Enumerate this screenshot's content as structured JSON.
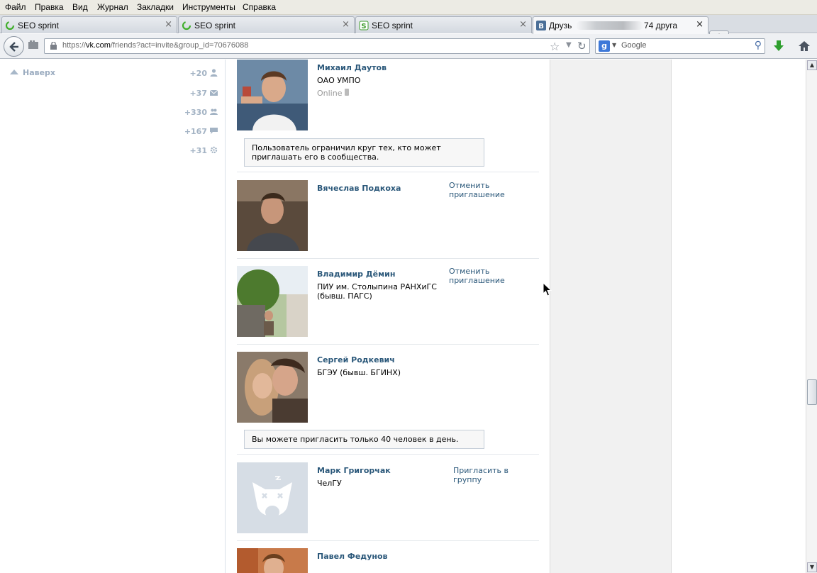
{
  "menu": [
    "Файл",
    "Правка",
    "Вид",
    "Журнал",
    "Закладки",
    "Инструменты",
    "Справка"
  ],
  "tabs": [
    {
      "label": "SEO sprint",
      "icon": "loading-spinner-icon"
    },
    {
      "label": "SEO sprint",
      "icon": "loading-spinner-icon"
    },
    {
      "label": "SEO sprint",
      "icon": "seosprint-logo-icon"
    },
    {
      "label": "Друзь",
      "label_suffix": "74 друга",
      "icon": "vk-logo-icon",
      "active": true
    }
  ],
  "tab_close": "×",
  "new_tab": "+",
  "address": {
    "prefix": "https://",
    "host": "vk.com",
    "path": "/friends?act=invite&group_id=70676088"
  },
  "search": {
    "placeholder": "Google"
  },
  "sidebar": {
    "top_label": "Наверх",
    "counters": [
      {
        "value": "+20",
        "icon": "person-icon"
      },
      {
        "value": "+37",
        "icon": "envelope-icon"
      },
      {
        "value": "+330",
        "icon": "group-icon"
      },
      {
        "value": "+167",
        "icon": "speech-bubble-icon"
      },
      {
        "value": "+31",
        "icon": "gear-icon"
      }
    ]
  },
  "users": [
    {
      "name": "Михаил Даутов",
      "info": "ОАО УМПО",
      "online": "Online",
      "action": "",
      "notice": "Пользователь ограничил круг тех, кто может приглашать его в сообщества."
    },
    {
      "name": "Вячеслав Подкоха",
      "info": "",
      "action": "Отменить приглашение"
    },
    {
      "name": "Владимир Дёмин",
      "info": "ПИУ им. Столыпина РАНХиГС (бывш. ПАГС)",
      "action": "Отменить приглашение"
    },
    {
      "name": "Сергей Родкевич",
      "info": "БГЭУ (бывш. БГИНХ)",
      "action": "",
      "notice": "Вы можете пригласить только 40 человек в день."
    },
    {
      "name": "Марк Григорчак",
      "info": "ЧелГУ",
      "action": "Пригласить в группу"
    },
    {
      "name": "Павел Федунов",
      "info": "",
      "action": ""
    }
  ],
  "colors": {
    "link": "#2b587a",
    "sidebar_counter": "#a3b3c4",
    "right_panel": "#f1f1f1"
  }
}
